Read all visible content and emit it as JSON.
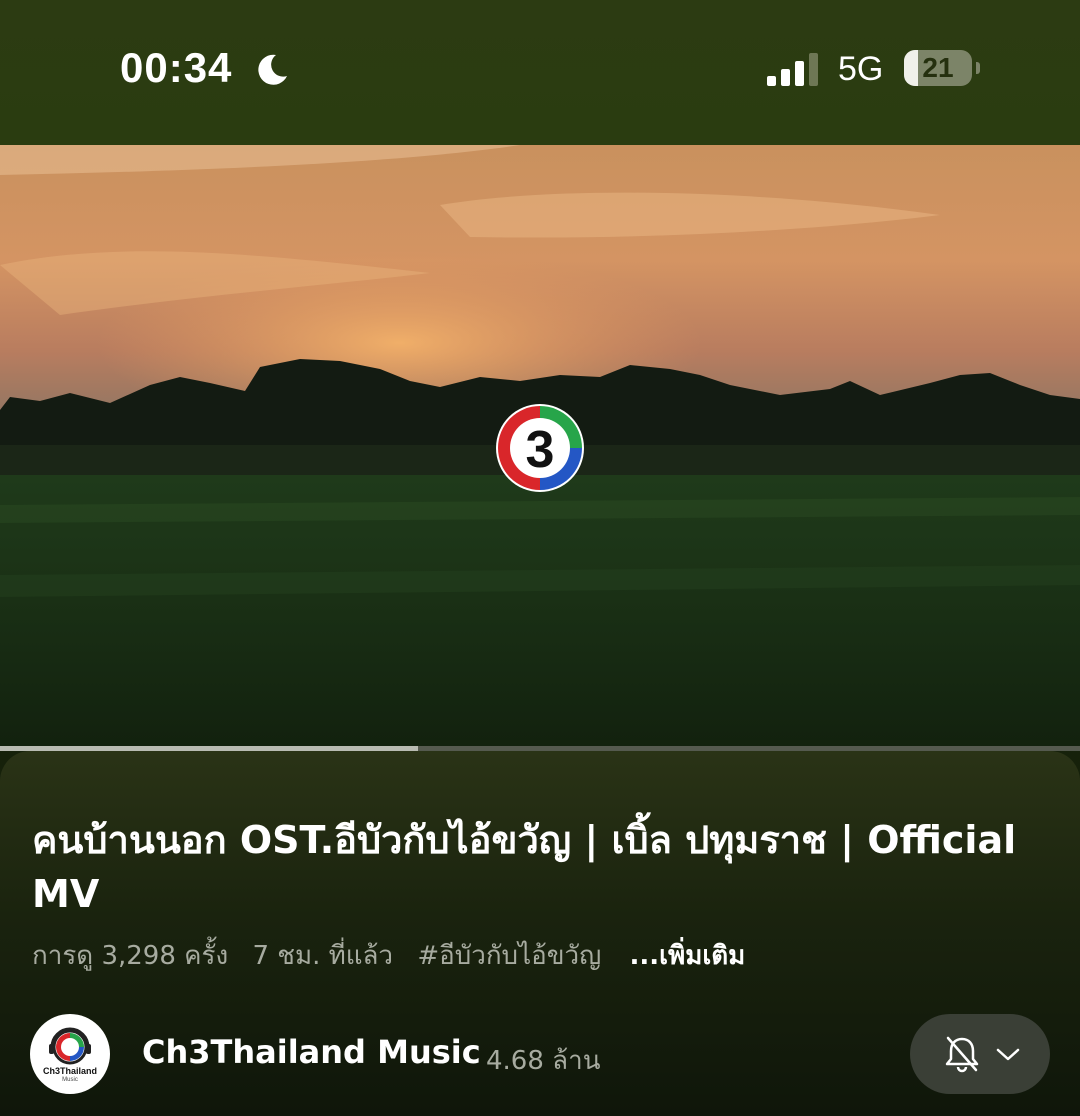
{
  "status_bar": {
    "time": "00:34",
    "network": "5G",
    "battery_percent": "21",
    "battery_level": 0.21,
    "icons": [
      "moon-icon",
      "signal-bars-icon",
      "battery-icon"
    ]
  },
  "video": {
    "logo_text": "3",
    "progress": 0.387
  },
  "info": {
    "title": "คนบ้านนอก OST.อีบัวกับไอ้ขวัญ | เบิ้ล ปทุมราช | Official MV",
    "views": "การดู 3,298 ครั้ง",
    "time_ago": "7 ชม. ที่แล้ว",
    "hashtag": "#อีบัวกับไอ้ขวัญ",
    "more": "...เพิ่มเติม"
  },
  "channel": {
    "avatar_text": "Ch3Thailand",
    "avatar_subtext": "Music",
    "name": "Ch3Thailand Music",
    "subscribers": "4.68 ล้าน",
    "icons": [
      "bell-off-icon",
      "chevron-down-icon"
    ]
  },
  "colors": {
    "status_bar_bg": "#2c3b12",
    "panel_bg": "#1a230e",
    "meta_text": "#a7aba0",
    "button_bg": "#3a3f36"
  }
}
